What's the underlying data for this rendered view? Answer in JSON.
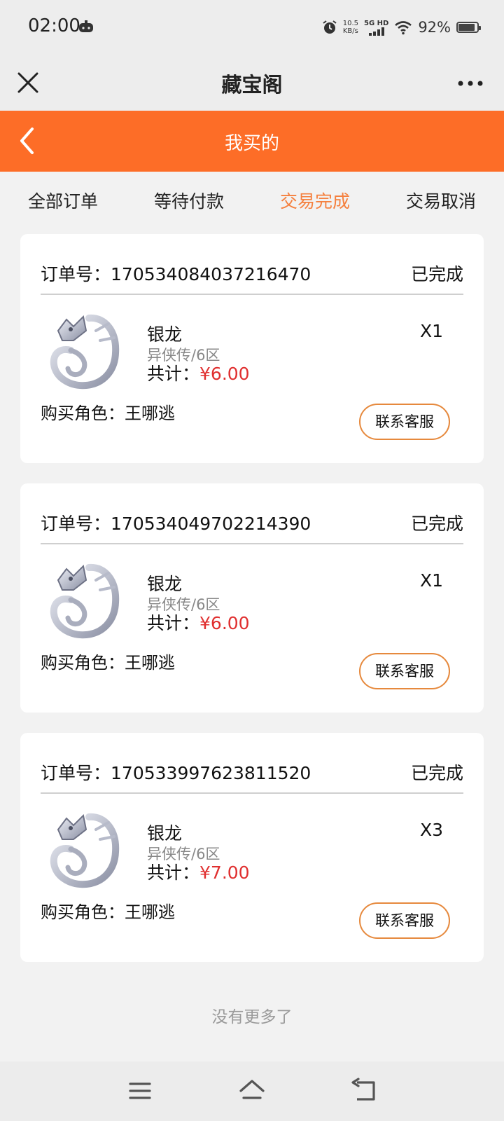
{
  "status_bar": {
    "time": "02:00",
    "net_speed_value": "10.5",
    "net_speed_unit": "KB/s",
    "network": "5G HD",
    "battery": "92%"
  },
  "title_bar": {
    "title": "藏宝阁"
  },
  "orange_bar": {
    "title": "我买的"
  },
  "tabs": [
    {
      "label": "全部订单",
      "active": false
    },
    {
      "label": "等待付款",
      "active": false
    },
    {
      "label": "交易完成",
      "active": true
    },
    {
      "label": "交易取消",
      "active": false
    }
  ],
  "orders": [
    {
      "order_label": "订单号：",
      "order_no": "170534084037216470",
      "status": "已完成",
      "item_name": "银龙",
      "server": "异侠传/6区",
      "total_label": "共计：",
      "price": "¥6.00",
      "qty": "X1",
      "role_label": "购买角色：",
      "role_name": "王哪逃",
      "button": "联系客服"
    },
    {
      "order_label": "订单号：",
      "order_no": "170534049702214390",
      "status": "已完成",
      "item_name": "银龙",
      "server": "异侠传/6区",
      "total_label": "共计：",
      "price": "¥6.00",
      "qty": "X1",
      "role_label": "购买角色：",
      "role_name": "王哪逃",
      "button": "联系客服"
    },
    {
      "order_label": "订单号：",
      "order_no": "170533997623811520",
      "status": "已完成",
      "item_name": "银龙",
      "server": "异侠传/6区",
      "total_label": "共计：",
      "price": "¥7.00",
      "qty": "X3",
      "role_label": "购买角色：",
      "role_name": "王哪逃",
      "button": "联系客服"
    }
  ],
  "footer_text": "没有更多了",
  "colors": {
    "accent": "#fd6d27",
    "active_tab": "#f5803e",
    "price": "#e02f2f",
    "button_border": "#e6893d"
  },
  "icons": {
    "close": "close-icon",
    "more": "more-icon",
    "back": "back-arrow-icon",
    "item": "silver-dragon-icon",
    "nav_menu": "menu-icon",
    "nav_home": "home-icon",
    "nav_back": "back-icon"
  }
}
